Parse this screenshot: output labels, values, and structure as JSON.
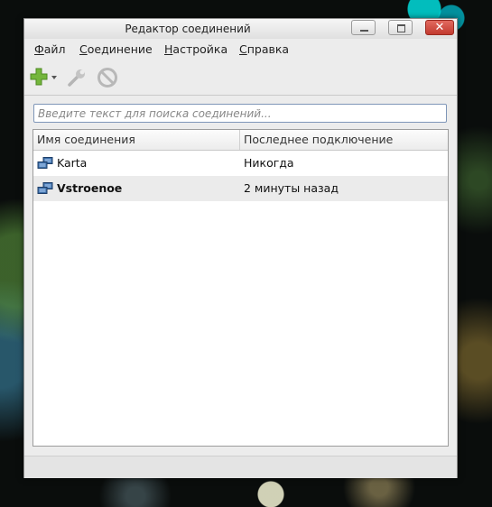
{
  "window": {
    "title": "Редактор соединений",
    "close_glyph": "✕"
  },
  "menu": [
    {
      "label_mnemonic": "Ф",
      "label_rest": "айл"
    },
    {
      "label_mnemonic": "С",
      "label_rest": "оединение"
    },
    {
      "label_mnemonic": "Н",
      "label_rest": "астройка"
    },
    {
      "label_mnemonic": "С",
      "label_rest": "правка"
    }
  ],
  "toolbar": {
    "add_icon": "add-plus-icon",
    "edit_icon": "wrench-icon",
    "delete_icon": "forbidden-icon",
    "add_color": "#74b63c"
  },
  "search": {
    "placeholder": "Введите текст для поиска соединений...",
    "value": ""
  },
  "list": {
    "columns": [
      "Имя соединения",
      "Последнее подключение"
    ],
    "rows": [
      {
        "name": "Karta",
        "last_connected": "Никогда",
        "icon": "network-connection-icon",
        "active": false
      },
      {
        "name": "Vstroenoe",
        "last_connected": "2 минуты назад",
        "icon": "network-connection-icon",
        "active": true
      }
    ]
  }
}
